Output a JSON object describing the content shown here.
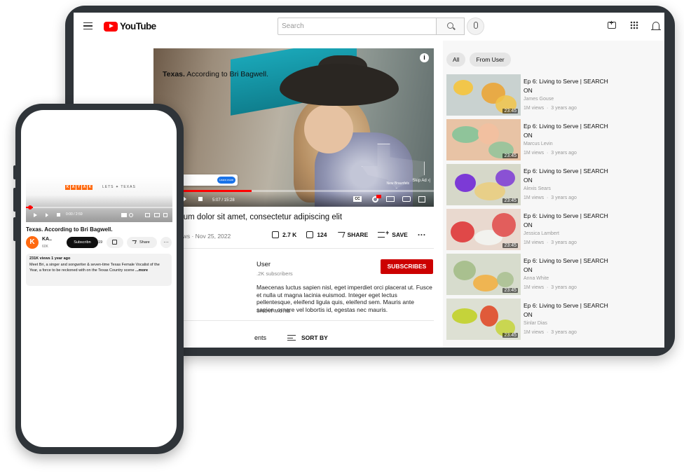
{
  "desktop": {
    "brand": "YouTube",
    "search": {
      "placeholder": "Search"
    },
    "player": {
      "title_bold": "Texas.",
      "title_rest": " According to Bri Bagwell.",
      "ad_cta": "Learn more",
      "skip": "Skip Ad ›|",
      "location": "New Braunfels",
      "time": "5:07 / 15:28",
      "progress": 0.35
    },
    "video": {
      "title": "sum dolor sit amet, consectetur adipiscing elit",
      "meta": "ews · Nov 25, 2022",
      "likes": "2.7 K",
      "dislikes": "124",
      "share": "SHARE",
      "save": "SAVE",
      "more": "···"
    },
    "channel": {
      "name": "User",
      "subs": ".2K subscribers",
      "subscribe": "SUBSCRIBES"
    },
    "description": "Maecenas luctus sapien nisl, eget imperdiet orci placerat ut. Fusce et nulla ut magna lacinia euismod. Integer eget lectus pellentesque, eleifend ligula quis, eleifend sem. Mauris ante sapien, ornare vel lobortis id, egestas nec mauris.",
    "show_more": "SHOW MORE",
    "comments": {
      "label": "ents",
      "sort": "SORT BY"
    },
    "chips": [
      "All",
      "From User"
    ],
    "recommendations": [
      {
        "title": "Ep 6: Living to Serve | SEARCH ON",
        "channel": "James Gouse",
        "views": "1M views",
        "age": "3 years ago",
        "duration": "23:45",
        "colors": [
          "#c9d2d0",
          "#f2c64a",
          "#e8aa46"
        ]
      },
      {
        "title": "Ep 6: Living to Serve | SEARCH ON",
        "channel": "Marcus Levin",
        "views": "1M views",
        "age": "3 years ago",
        "duration": "23:45",
        "colors": [
          "#e8c3a5",
          "#8fc49a",
          "#f2c0a0"
        ]
      },
      {
        "title": "Ep 6: Living to Serve | SEARCH ON",
        "channel": "Alexis Sears",
        "views": "1M views",
        "age": "3 years ago",
        "duration": "23:45",
        "colors": [
          "#d6d8c9",
          "#7c3ad6",
          "#e8cf88"
        ]
      },
      {
        "title": "Ep 6: Living to Serve | SEARCH ON",
        "channel": "Jessica Lambert",
        "views": "1M views",
        "age": "3 years ago",
        "duration": "23:45",
        "colors": [
          "#e9d9cf",
          "#e04848",
          "#f2f2ee"
        ]
      },
      {
        "title": "Ep 6: Living to Serve | SEARCH ON",
        "channel": "Anna White",
        "views": "1M views",
        "age": "3 years ago",
        "duration": "23:45",
        "colors": [
          "#d7dccd",
          "#a9c08f",
          "#efb552"
        ]
      },
      {
        "title": "Ep 6: Living to Serve | SEARCH ON",
        "channel": "Sinlar Dias",
        "views": "1M views",
        "age": "3 years ago",
        "duration": "23:45",
        "colors": [
          "#dde0d3",
          "#c5d33a",
          "#e05a3a"
        ]
      }
    ]
  },
  "mobile": {
    "logo_letters": [
      "K",
      "A",
      "Y",
      "A",
      "K"
    ],
    "lets_texas": "LETS ✦ TEXAS",
    "time": "0:00 / 2:59",
    "title": "Texas. According to Bri Bagwell.",
    "avatar_letter": "K",
    "channel": "KA..",
    "subs": "60K",
    "subscribe": "Subscribn",
    "likes": "19",
    "share": "Share",
    "desc_meta": "231K views  1 year ago",
    "desc": "Meet Bri, a singer and songwriter & seven-time Texas Female Vocalist of the Year, a force to be reckoned with on the Texas Country scene",
    "desc_more": "...more"
  }
}
